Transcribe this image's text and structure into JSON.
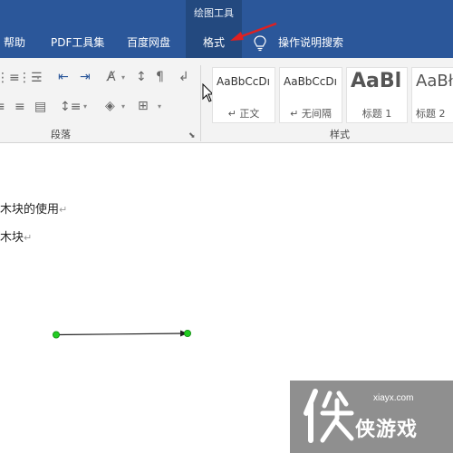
{
  "titlebar": {
    "contextual_tab_group": "绘图工具"
  },
  "tabs": [
    {
      "label": "帮助"
    },
    {
      "label": "PDF工具集"
    },
    {
      "label": "百度网盘"
    },
    {
      "label": "格式"
    },
    {
      "label": "操作说明搜索"
    }
  ],
  "ribbon": {
    "paragraph_group_label": "段落",
    "styles_group_label": "样式",
    "styles": [
      {
        "sample": "AaBbCcDı",
        "name": "↵ 正文"
      },
      {
        "sample": "AaBbCcDı",
        "name": "↵ 无间隔"
      },
      {
        "sample": "AaBl",
        "name": "标题 1"
      },
      {
        "sample": "AaBł",
        "name": "标题 2"
      }
    ]
  },
  "document": {
    "line1": "木块的使用",
    "line2": "木块",
    "paragraph_mark": "↵"
  },
  "watermark": {
    "brand": "侠游戏",
    "url": "xiayx.com"
  },
  "colors": {
    "ribbon_blue": "#2b579a",
    "active_tab": "#23497f",
    "ribbon_bg": "#f3f3f3",
    "annotation_arrow": "#e02020",
    "handle_green": "#22cc22"
  }
}
